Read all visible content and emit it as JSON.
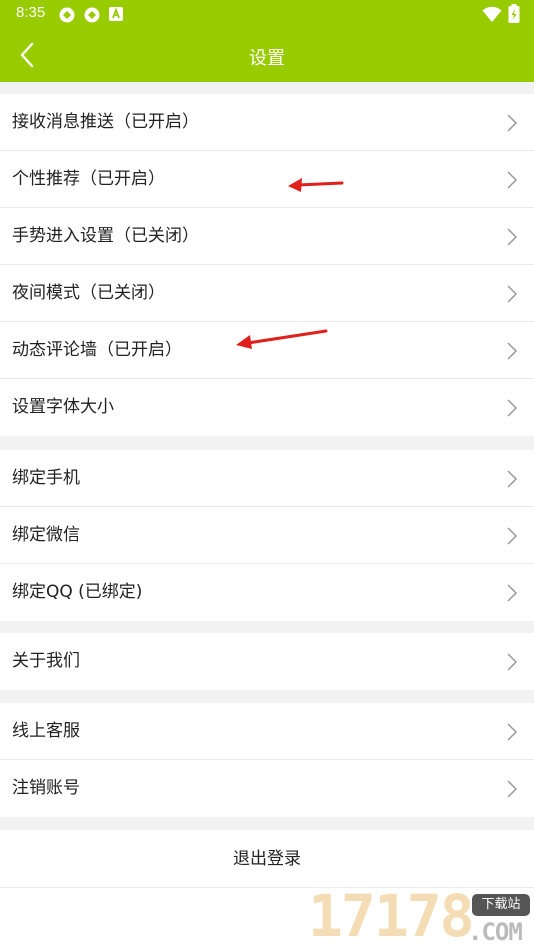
{
  "status_bar": {
    "time": "8:35",
    "icons": [
      "sync-icon",
      "sync-icon",
      "text-a-icon",
      "wifi-icon",
      "battery-charging-icon"
    ]
  },
  "header": {
    "title": "设置",
    "back_icon": "chevron-left-icon",
    "color": "#99cc00"
  },
  "groups": [
    {
      "items": [
        {
          "label": "接收消息推送（已开启）"
        },
        {
          "label": "个性推荐（已开启）"
        },
        {
          "label": "手势进入设置（已关闭）"
        },
        {
          "label": "夜间模式（已关闭）"
        },
        {
          "label": "动态评论墙（已开启）"
        },
        {
          "label": "设置字体大小"
        }
      ]
    },
    {
      "items": [
        {
          "label": "绑定手机"
        },
        {
          "label": "绑定微信"
        },
        {
          "label": "绑定QQ (已绑定)"
        }
      ]
    },
    {
      "items": [
        {
          "label": "关于我们"
        }
      ]
    },
    {
      "items": [
        {
          "label": "线上客服"
        },
        {
          "label": "注销账号"
        }
      ]
    }
  ],
  "logout": {
    "label": "退出登录"
  },
  "annotations": {
    "arrow_color": "#e0201a"
  },
  "watermark": {
    "digits": "17178",
    "badge": "下载站",
    "domain": ".COM"
  }
}
